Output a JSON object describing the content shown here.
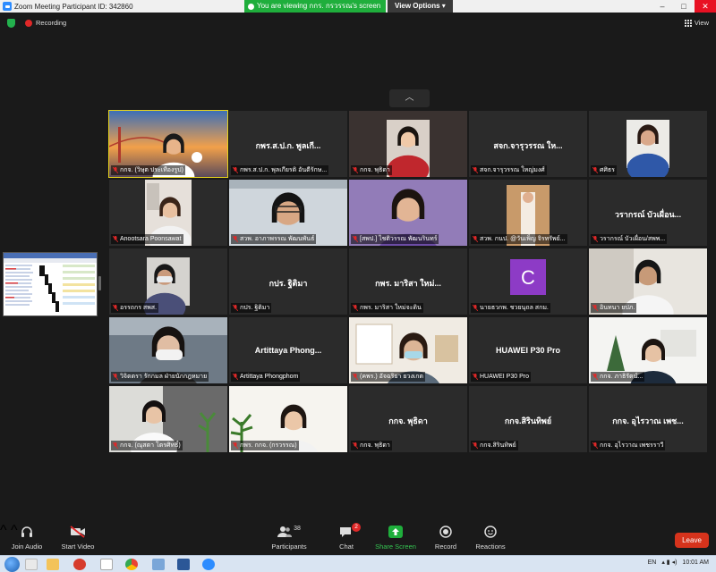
{
  "window": {
    "title": "Zoom Meeting Participant ID: 342860",
    "viewing_banner": "You are viewing กกร. กรวรรณ's screen",
    "view_options": "View Options",
    "controls": [
      "–",
      "□",
      "✕"
    ]
  },
  "status": {
    "recording": "Recording",
    "view": "View"
  },
  "tiles": [
    {
      "label": "กกจ. (วิษุต ประเทืองรูป)",
      "big": "",
      "video": "sunset",
      "active": true
    },
    {
      "label": "กพร.ส.ป.ก. พุลเกียรติ อันตีรักษ...",
      "big": "กพร.ส.ป.ก. พูลเกี...",
      "video": ""
    },
    {
      "label": "กกจ. พุธิดา",
      "big": "",
      "video": "woman-red"
    },
    {
      "label": "สจก.จารุวรรณ ใหญ่มงศ์",
      "big": "สจก.จารุวรรณ ให...",
      "video": ""
    },
    {
      "label": "ศศิธร",
      "big": "",
      "video": "woman-blue"
    },
    {
      "label": "Anootsara Poonsawat",
      "big": "",
      "video": "woman-room"
    },
    {
      "label": "สวพ. อาภาพรรณ พัฒนพันธ์",
      "big": "",
      "video": "man-glasses"
    },
    {
      "label": "[สพป.] ไชติวรรณ พัฒนรินทร์",
      "big": "",
      "video": "woman-purple"
    },
    {
      "label": "สวพ. กนป. @วันเพ็ญ จิรทรัพย์...",
      "big": "",
      "video": "woman-standing"
    },
    {
      "label": "วรากรณ์ บัวเผื่อน/สพพ...",
      "big": "วรากรณ์ บัวเผื่อน...",
      "video": ""
    },
    {
      "label": "อรรถกร สพส.",
      "big": "",
      "video": "man-mask"
    },
    {
      "label": "กปร. ฐิติมา",
      "big": "กปร. ฐิติมา",
      "video": ""
    },
    {
      "label": "กพร. มาริสา ใหม่จะดิน",
      "big": "กพร. มาริสา ใหม่...",
      "video": ""
    },
    {
      "label": "นายธวกพ. ชวยนุถล สกม.",
      "big": "",
      "video": "avatar-c",
      "avatar_letter": "C"
    },
    {
      "label": "อินทนา ยปภ.",
      "big": "",
      "video": "man-office"
    },
    {
      "label": "วิจิตตรา รักกมล ฝ่ายนักกฎหมาย",
      "big": "",
      "video": "woman-mask"
    },
    {
      "label": "Artittaya Phongphom",
      "big": "Artittaya Phong...",
      "video": ""
    },
    {
      "label": "(คพร.) อัจฉริยา ยวงเกต",
      "big": "",
      "video": "woman-window"
    },
    {
      "label": "HUAWEI P30 Pro",
      "big": "HUAWEI P30 Pro",
      "video": ""
    },
    {
      "label": "กกจ. ภาธิรัตน์...",
      "big": "",
      "video": "woman-white"
    },
    {
      "label": "กกจ. (ณุสตา โตรศิทธิ์)",
      "big": "",
      "video": "woman-plant"
    },
    {
      "label": "กพร. กกจ. (กรวรรณ)",
      "big": "",
      "video": "woman-bright"
    },
    {
      "label": "กกจ. พุธิดา",
      "big": "กกจ. พุธิดา",
      "video": ""
    },
    {
      "label": "กกจ.สิรินทิพย์",
      "big": "กกจ.สิรินทิพย์",
      "video": ""
    },
    {
      "label": "กกจ. อุไรวาณ เพชรราวี",
      "big": "กกจ. อุไรวาณ เพช...",
      "video": ""
    }
  ],
  "toolbar": {
    "join_audio": "Join Audio",
    "start_video": "Start Video",
    "participants": "Participants",
    "participants_count": "38",
    "chat": "Chat",
    "chat_badge": "2",
    "share_screen": "Share Screen",
    "record": "Record",
    "reactions": "Reactions",
    "leave": "Leave"
  },
  "taskbar": {
    "lang": "EN",
    "time": "10:01 AM"
  },
  "colors": {
    "share_green": "#1fae3c",
    "leave_red": "#d6331c",
    "active_outline": "#e8d51b",
    "muted_mic": "#e02828"
  }
}
